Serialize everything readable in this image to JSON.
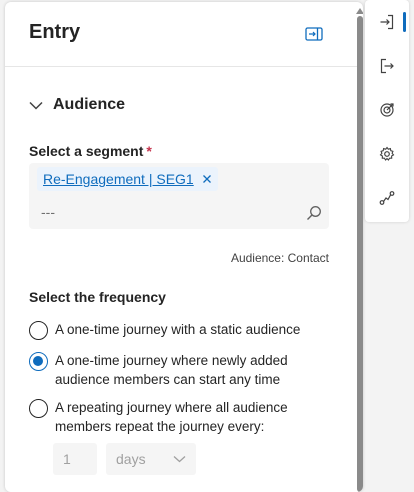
{
  "panel": {
    "title": "Entry"
  },
  "section": {
    "title": "Audience",
    "expanded": true
  },
  "segment": {
    "label": "Select a segment",
    "required_marker": "*",
    "selected_tag": "Re-Engagement | SEG1",
    "input_placeholder": "---",
    "audience_note": "Audience: Contact"
  },
  "frequency": {
    "label": "Select the frequency",
    "options": [
      {
        "label": "A one-time journey with a static audience",
        "selected": false
      },
      {
        "label": "A one-time journey where newly added audience members can start any time",
        "selected": true
      },
      {
        "label": "A repeating journey where all audience members repeat the journey every:",
        "selected": false
      }
    ],
    "repeat_value": "1",
    "repeat_unit": "days"
  },
  "rail": {
    "items": [
      {
        "icon": "entry-icon",
        "active": true
      },
      {
        "icon": "exit-icon",
        "active": false
      },
      {
        "icon": "goal-icon",
        "active": false
      },
      {
        "icon": "settings-icon",
        "active": false
      },
      {
        "icon": "flow-icon",
        "active": false
      }
    ]
  },
  "colors": {
    "accent": "#0f6cbd",
    "required": "#c4314b",
    "tag_background": "#ebf3fc",
    "field_background": "#f5f5f5"
  }
}
